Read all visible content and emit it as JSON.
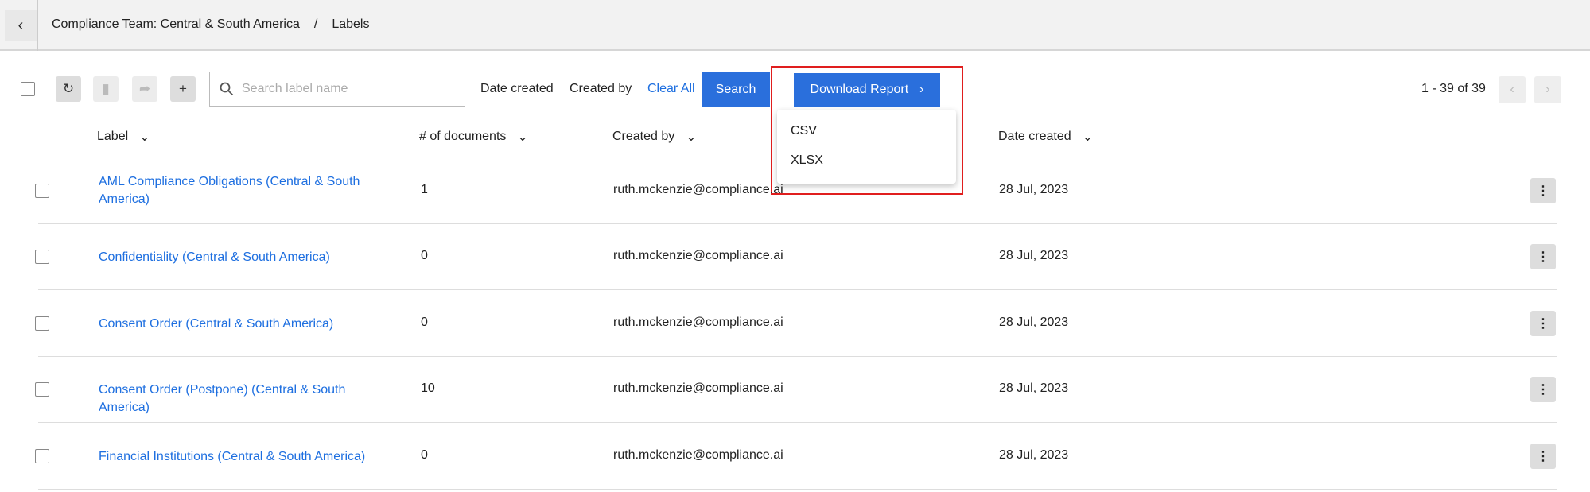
{
  "header": {
    "breadcrumb": [
      "Compliance Team: Central & South America",
      "Labels"
    ],
    "separator": "/"
  },
  "toolbar": {
    "search_placeholder": "Search label name",
    "date_created": "Date created",
    "created_by": "Created by",
    "clear_all": "Clear All",
    "search": "Search",
    "download_report": "Download Report",
    "pagination": "1 - 39 of 39"
  },
  "download_menu": [
    "CSV",
    "XLSX"
  ],
  "table": {
    "columns": [
      "Label",
      "# of documents",
      "Created by",
      "Date created"
    ],
    "rows": [
      {
        "label": "AML Compliance Obligations (Central & South America)",
        "docs": "1",
        "created_by": "ruth.mckenzie@compliance.ai",
        "date": "28 Jul, 2023"
      },
      {
        "label": "Confidentiality (Central & South America)",
        "docs": "0",
        "created_by": "ruth.mckenzie@compliance.ai",
        "date": "28 Jul, 2023"
      },
      {
        "label": "Consent Order (Central & South America)",
        "docs": "0",
        "created_by": "ruth.mckenzie@compliance.ai",
        "date": "28 Jul, 2023"
      },
      {
        "label": "Consent Order (Postpone) (Central & South America)",
        "docs": "10",
        "created_by": "ruth.mckenzie@compliance.ai",
        "date": "28 Jul, 2023"
      },
      {
        "label": "Financial Institutions (Central & South America)",
        "docs": "0",
        "created_by": "ruth.mckenzie@compliance.ai",
        "date": "28 Jul, 2023"
      }
    ]
  },
  "colors": {
    "accent": "#2a6fdc",
    "link": "#1e6fe0",
    "highlight": "#e01e1e"
  }
}
